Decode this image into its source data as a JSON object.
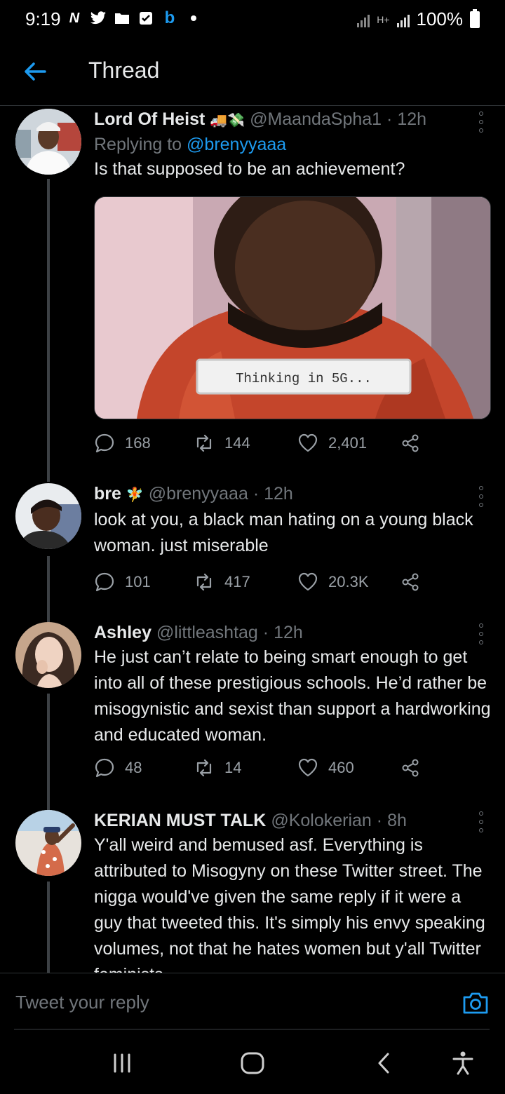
{
  "status_bar": {
    "time": "9:19",
    "notification_icons": [
      "nfc-n-icon",
      "twitter-icon",
      "folder-icon",
      "checkbox-icon",
      "b-app-icon",
      "dot-icon"
    ],
    "battery": "100%",
    "network_label": "H+"
  },
  "header": {
    "title": "Thread"
  },
  "tweets": [
    {
      "name": "Lord Of Heist",
      "emoji": "🚚💸",
      "handle": "@MaandaSpha1",
      "time": "12h",
      "replying_prefix": "Replying to",
      "replying_to": "@brenyyaaa",
      "text": "Is that supposed to be an achievement?",
      "media_caption": "Thinking in 5G...",
      "replies": "168",
      "retweets": "144",
      "likes": "2,401"
    },
    {
      "name": "bre",
      "emoji": "🧚",
      "handle": "@brenyyaaa",
      "time": "12h",
      "text": "look at you, a black man hating on a young black woman. just miserable",
      "replies": "101",
      "retweets": "417",
      "likes": "20.3K"
    },
    {
      "name": "Ashley",
      "emoji": "",
      "handle": "@littleashtag",
      "time": "12h",
      "text": "He just can’t relate to being smart enough to get into all of these prestigious schools. He’d rather be misogynistic and sexist than support a hardworking and educated woman.",
      "replies": "48",
      "retweets": "14",
      "likes": "460"
    },
    {
      "name": "KERIAN MUST TALK",
      "emoji": "",
      "handle": "@Kolokerian",
      "time": "8h",
      "text": "Y'all weird and bemused asf. Everything is attributed to Misogyny on these Twitter street. The nigga would've given the same reply if it were a guy that tweeted this. It's simply his envy speaking volumes, not that he hates women but y'all Twitter feminists"
    }
  ],
  "compose": {
    "placeholder": "Tweet your reply"
  },
  "colors": {
    "accent": "#1d9bf0",
    "background": "#000000",
    "secondary_text": "#71767b"
  }
}
